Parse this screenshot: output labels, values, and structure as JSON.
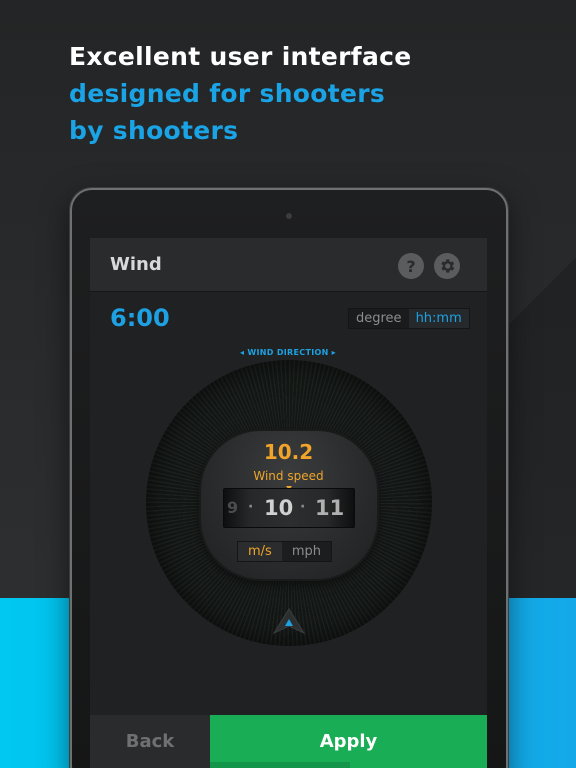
{
  "headline": {
    "line1": "Excellent user interface",
    "line2": "designed for shooters",
    "line3": "by shooters"
  },
  "app": {
    "title": "Wind",
    "help_icon": "?",
    "icons": [
      "help-icon",
      "gear-icon"
    ]
  },
  "time": {
    "value": "6:00",
    "format_options": [
      "degree",
      "hh:mm"
    ],
    "selected_format": "hh:mm"
  },
  "dial": {
    "direction_label": "WIND DIRECTION",
    "speed_value": "10.2",
    "speed_label": "Wind speed",
    "picker": {
      "prev": "9",
      "current": "10",
      "next": "11",
      "separator": "·"
    },
    "units": [
      "m/s",
      "mph"
    ],
    "selected_unit": "m/s"
  },
  "actions": {
    "back_label": "Back",
    "apply_label": "Apply"
  },
  "colors": {
    "accent_blue": "#1da1e2",
    "accent_orange": "#f0a52a",
    "apply_green": "#19ad55",
    "band_cyan": "#00c8f0"
  }
}
